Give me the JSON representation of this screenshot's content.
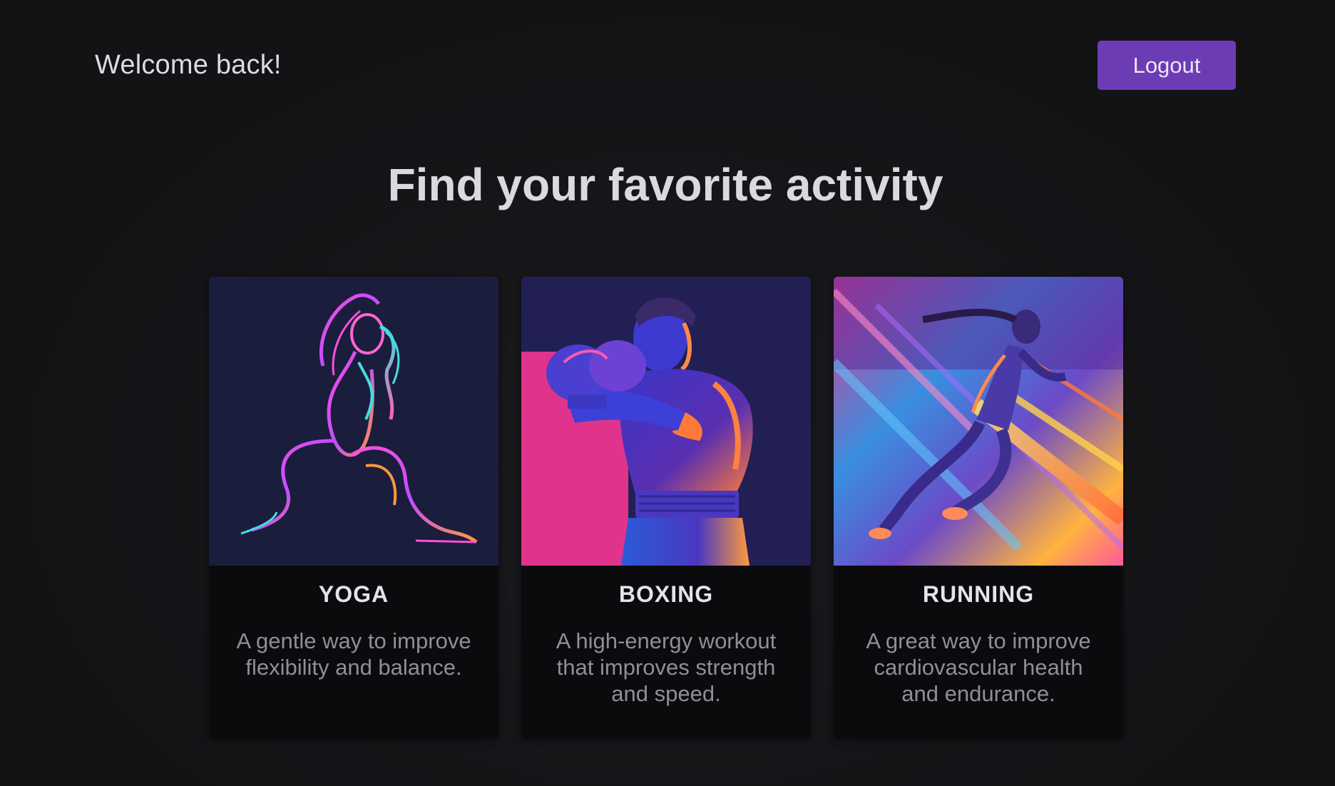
{
  "header": {
    "welcome_text": "Welcome back!",
    "logout_label": "Logout"
  },
  "main": {
    "headline": "Find your favorite activity"
  },
  "activities": [
    {
      "title": "YOGA",
      "description": "A gentle way to improve flexibility and balance.",
      "image_icon": "yoga-illustration"
    },
    {
      "title": "BOXING",
      "description": "A high-energy workout that improves strength and speed.",
      "image_icon": "boxing-illustration"
    },
    {
      "title": "RUNNING",
      "description": "A great way to improve cardiovascular health and endurance.",
      "image_icon": "running-illustration"
    }
  ],
  "colors": {
    "background": "#131316",
    "card_background": "#0b0b0d",
    "accent": "#6c3cb4",
    "heading_text": "#d9d9de",
    "muted_text": "#8f8f95"
  }
}
